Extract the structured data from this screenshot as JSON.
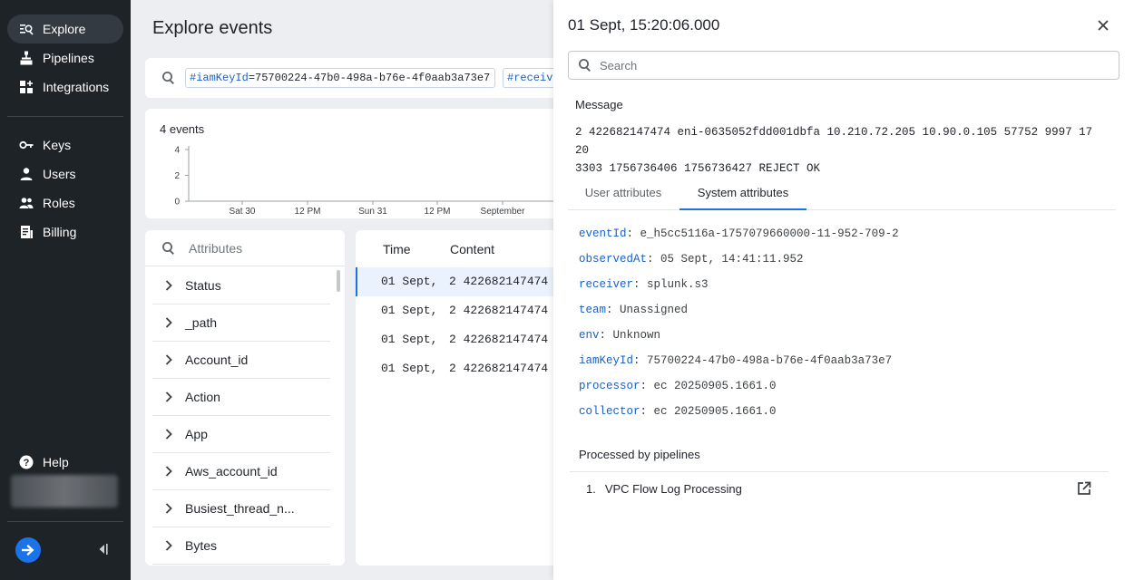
{
  "sidebar": {
    "items": [
      {
        "label": "Explore",
        "icon": "explore-icon"
      },
      {
        "label": "Pipelines",
        "icon": "pipelines-icon"
      },
      {
        "label": "Integrations",
        "icon": "integrations-icon"
      },
      {
        "label": "Keys",
        "icon": "key-icon"
      },
      {
        "label": "Users",
        "icon": "user-icon"
      },
      {
        "label": "Roles",
        "icon": "roles-icon"
      },
      {
        "label": "Billing",
        "icon": "billing-icon"
      }
    ],
    "help_label": "Help",
    "active": "Explore"
  },
  "main": {
    "title": "Explore events",
    "query_chips": [
      {
        "key": "#iamKeyId",
        "value": "=75700224-47b0-498a-b76e-4f0aab3a73e7"
      },
      {
        "key": "#receiv",
        "value": ""
      }
    ],
    "events_count": "4 events",
    "attributes_placeholder": "Attributes",
    "attributes": [
      "Status",
      "_path",
      "Account_id",
      "Action",
      "App",
      "Aws_account_id",
      "Busiest_thread_n...",
      "Bytes"
    ],
    "events_table": {
      "headers": [
        "Time",
        "Content"
      ],
      "rows": [
        {
          "time": "01 Sept,",
          "content": "2 422682147474 e"
        },
        {
          "time": "01 Sept,",
          "content": "2 422682147474 e"
        },
        {
          "time": "01 Sept,",
          "content": "2 422682147474 e"
        },
        {
          "time": "01 Sept,",
          "content": "2 422682147474 e"
        }
      ]
    }
  },
  "chart_data": {
    "type": "bar",
    "title": "",
    "xlabel": "",
    "ylabel": "",
    "ylim": [
      0,
      4
    ],
    "y_ticks": [
      "0",
      "2",
      "4"
    ],
    "x_ticks": [
      "Sat 30",
      "12 PM",
      "Sun 31",
      "12 PM",
      "September"
    ],
    "grid": false
  },
  "drawer": {
    "title": "01 Sept, 15:20:06.000",
    "search_placeholder": "Search",
    "message_label": "Message",
    "message_line1": "2 422682147474 eni-0635052fdd001dbfa 10.210.72.205 10.90.0.105 57752 9997 17 20",
    "message_line2": "3303 1756736406 1756736427 REJECT OK",
    "tabs": [
      "User attributes",
      "System attributes"
    ],
    "active_tab": "System attributes",
    "system_attributes": [
      {
        "key": "eventId",
        "value": "e_h5cc5116a-1757079660000-11-952-709-2"
      },
      {
        "key": "observedAt",
        "value": "05 Sept, 14:41:11.952"
      },
      {
        "key": "receiver",
        "value": "splunk.s3"
      },
      {
        "key": "team",
        "value": "Unassigned"
      },
      {
        "key": "env",
        "value": "Unknown"
      },
      {
        "key": "iamKeyId",
        "value": "75700224-47b0-498a-b76e-4f0aab3a73e7"
      },
      {
        "key": "processor",
        "value": "ec 20250905.1661.0"
      },
      {
        "key": "collector",
        "value": "ec 20250905.1661.0"
      }
    ],
    "processed_title": "Processed by pipelines",
    "pipelines": [
      {
        "num": "1.",
        "name": "VPC Flow Log Processing"
      }
    ]
  },
  "colors": {
    "accent": "#1a73e8",
    "sidebar_bg": "#1e2328",
    "key_blue": "#1a60c4"
  }
}
